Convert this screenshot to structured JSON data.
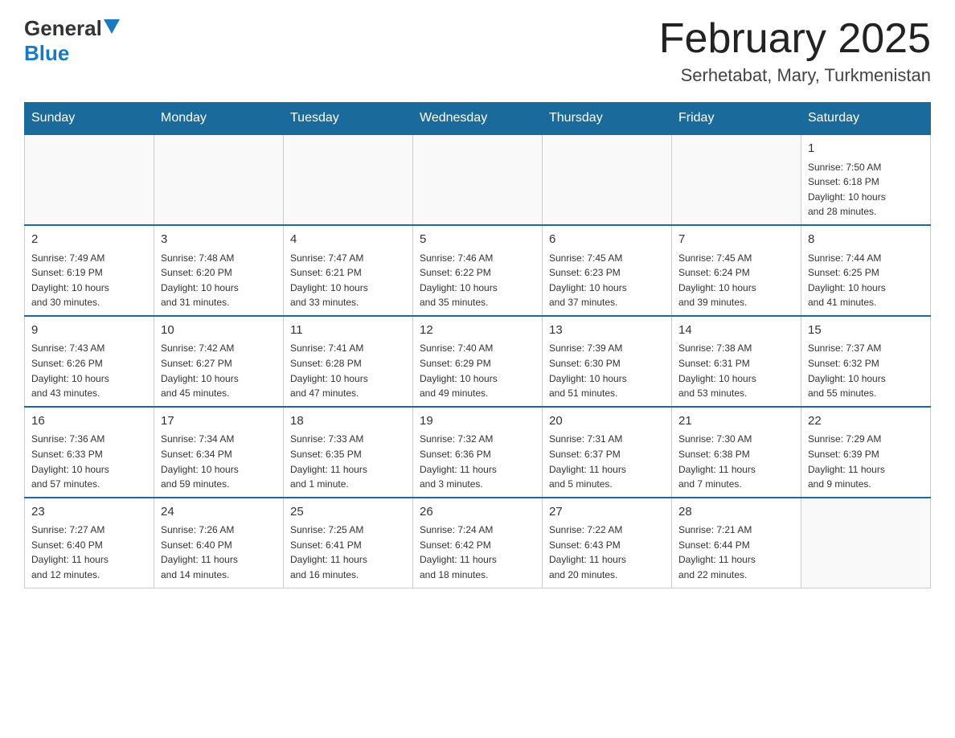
{
  "logo": {
    "general": "General",
    "blue": "Blue"
  },
  "title": {
    "month_year": "February 2025",
    "location": "Serhetabat, Mary, Turkmenistan"
  },
  "weekdays": [
    "Sunday",
    "Monday",
    "Tuesday",
    "Wednesday",
    "Thursday",
    "Friday",
    "Saturday"
  ],
  "weeks": [
    [
      {
        "day": "",
        "info": ""
      },
      {
        "day": "",
        "info": ""
      },
      {
        "day": "",
        "info": ""
      },
      {
        "day": "",
        "info": ""
      },
      {
        "day": "",
        "info": ""
      },
      {
        "day": "",
        "info": ""
      },
      {
        "day": "1",
        "info": "Sunrise: 7:50 AM\nSunset: 6:18 PM\nDaylight: 10 hours\nand 28 minutes."
      }
    ],
    [
      {
        "day": "2",
        "info": "Sunrise: 7:49 AM\nSunset: 6:19 PM\nDaylight: 10 hours\nand 30 minutes."
      },
      {
        "day": "3",
        "info": "Sunrise: 7:48 AM\nSunset: 6:20 PM\nDaylight: 10 hours\nand 31 minutes."
      },
      {
        "day": "4",
        "info": "Sunrise: 7:47 AM\nSunset: 6:21 PM\nDaylight: 10 hours\nand 33 minutes."
      },
      {
        "day": "5",
        "info": "Sunrise: 7:46 AM\nSunset: 6:22 PM\nDaylight: 10 hours\nand 35 minutes."
      },
      {
        "day": "6",
        "info": "Sunrise: 7:45 AM\nSunset: 6:23 PM\nDaylight: 10 hours\nand 37 minutes."
      },
      {
        "day": "7",
        "info": "Sunrise: 7:45 AM\nSunset: 6:24 PM\nDaylight: 10 hours\nand 39 minutes."
      },
      {
        "day": "8",
        "info": "Sunrise: 7:44 AM\nSunset: 6:25 PM\nDaylight: 10 hours\nand 41 minutes."
      }
    ],
    [
      {
        "day": "9",
        "info": "Sunrise: 7:43 AM\nSunset: 6:26 PM\nDaylight: 10 hours\nand 43 minutes."
      },
      {
        "day": "10",
        "info": "Sunrise: 7:42 AM\nSunset: 6:27 PM\nDaylight: 10 hours\nand 45 minutes."
      },
      {
        "day": "11",
        "info": "Sunrise: 7:41 AM\nSunset: 6:28 PM\nDaylight: 10 hours\nand 47 minutes."
      },
      {
        "day": "12",
        "info": "Sunrise: 7:40 AM\nSunset: 6:29 PM\nDaylight: 10 hours\nand 49 minutes."
      },
      {
        "day": "13",
        "info": "Sunrise: 7:39 AM\nSunset: 6:30 PM\nDaylight: 10 hours\nand 51 minutes."
      },
      {
        "day": "14",
        "info": "Sunrise: 7:38 AM\nSunset: 6:31 PM\nDaylight: 10 hours\nand 53 minutes."
      },
      {
        "day": "15",
        "info": "Sunrise: 7:37 AM\nSunset: 6:32 PM\nDaylight: 10 hours\nand 55 minutes."
      }
    ],
    [
      {
        "day": "16",
        "info": "Sunrise: 7:36 AM\nSunset: 6:33 PM\nDaylight: 10 hours\nand 57 minutes."
      },
      {
        "day": "17",
        "info": "Sunrise: 7:34 AM\nSunset: 6:34 PM\nDaylight: 10 hours\nand 59 minutes."
      },
      {
        "day": "18",
        "info": "Sunrise: 7:33 AM\nSunset: 6:35 PM\nDaylight: 11 hours\nand 1 minute."
      },
      {
        "day": "19",
        "info": "Sunrise: 7:32 AM\nSunset: 6:36 PM\nDaylight: 11 hours\nand 3 minutes."
      },
      {
        "day": "20",
        "info": "Sunrise: 7:31 AM\nSunset: 6:37 PM\nDaylight: 11 hours\nand 5 minutes."
      },
      {
        "day": "21",
        "info": "Sunrise: 7:30 AM\nSunset: 6:38 PM\nDaylight: 11 hours\nand 7 minutes."
      },
      {
        "day": "22",
        "info": "Sunrise: 7:29 AM\nSunset: 6:39 PM\nDaylight: 11 hours\nand 9 minutes."
      }
    ],
    [
      {
        "day": "23",
        "info": "Sunrise: 7:27 AM\nSunset: 6:40 PM\nDaylight: 11 hours\nand 12 minutes."
      },
      {
        "day": "24",
        "info": "Sunrise: 7:26 AM\nSunset: 6:40 PM\nDaylight: 11 hours\nand 14 minutes."
      },
      {
        "day": "25",
        "info": "Sunrise: 7:25 AM\nSunset: 6:41 PM\nDaylight: 11 hours\nand 16 minutes."
      },
      {
        "day": "26",
        "info": "Sunrise: 7:24 AM\nSunset: 6:42 PM\nDaylight: 11 hours\nand 18 minutes."
      },
      {
        "day": "27",
        "info": "Sunrise: 7:22 AM\nSunset: 6:43 PM\nDaylight: 11 hours\nand 20 minutes."
      },
      {
        "day": "28",
        "info": "Sunrise: 7:21 AM\nSunset: 6:44 PM\nDaylight: 11 hours\nand 22 minutes."
      },
      {
        "day": "",
        "info": ""
      }
    ]
  ]
}
